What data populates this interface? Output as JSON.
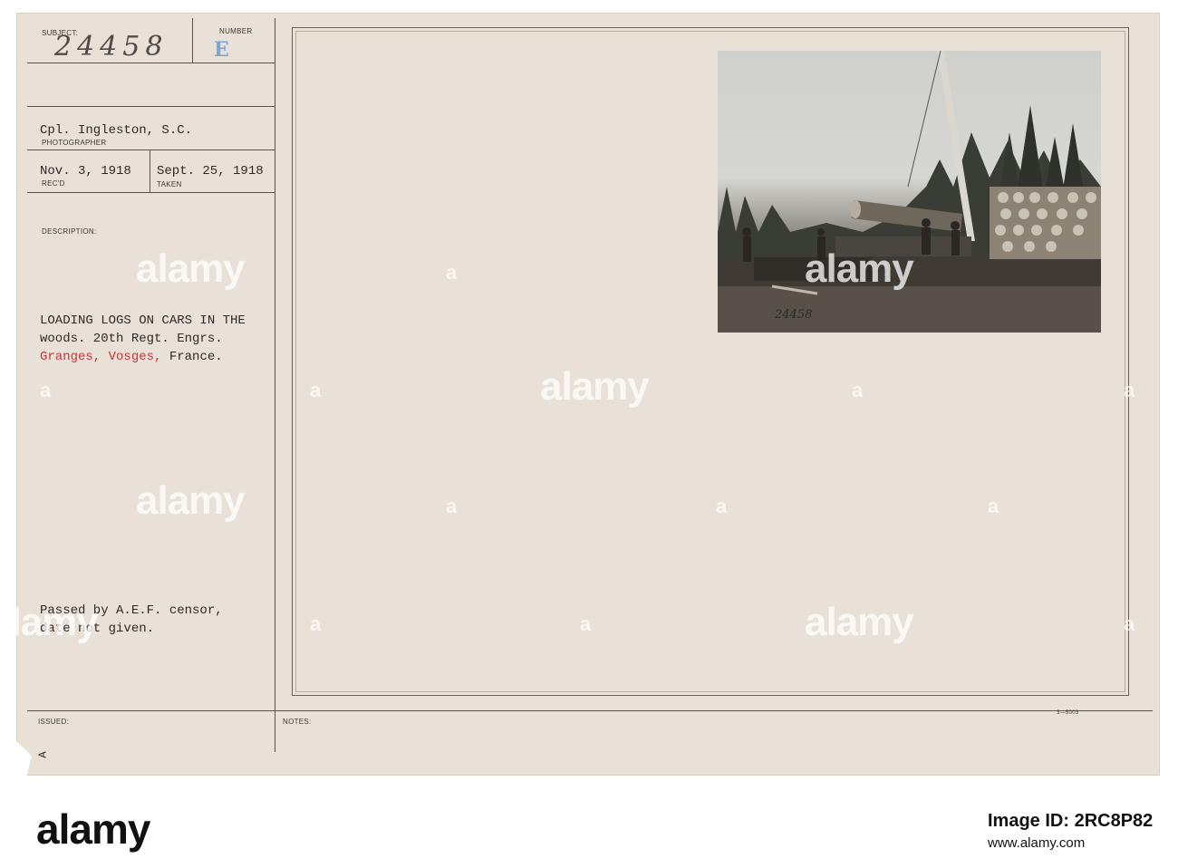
{
  "card": {
    "subject_label": "SUBJECT:",
    "number_label": "NUMBER",
    "subject_number": "24458",
    "number_letter": "E",
    "photographer": "Cpl. Ingleston, S.C.",
    "photographer_label": "PHOTOGRAPHER",
    "received_date": "Nov. 3, 1918",
    "received_label": "REC'D",
    "taken_date": "Sept. 25, 1918",
    "taken_label": "TAKEN",
    "description_label": "DESCRIPTION:",
    "description_line1": "LOADING LOGS ON CARS IN THE",
    "description_line2": "woods. 20th Regt. Engrs.",
    "location_place1": "Granges,",
    "location_place2": "Vosges,",
    "location_country": "France.",
    "censor_line1": "Passed by A.E.F. censor,",
    "censor_line2": "date not given.",
    "issued_label": "ISSUED:",
    "notes_label": "NOTES:",
    "corner_mark": "A",
    "form_number": "3—5003",
    "photo_inscription": "24458"
  },
  "watermarks": {
    "brand": "alamy",
    "letter": "a"
  },
  "footer": {
    "brand": "alamy",
    "image_id": "Image ID: 2RC8P82",
    "url": "www.alamy.com"
  }
}
